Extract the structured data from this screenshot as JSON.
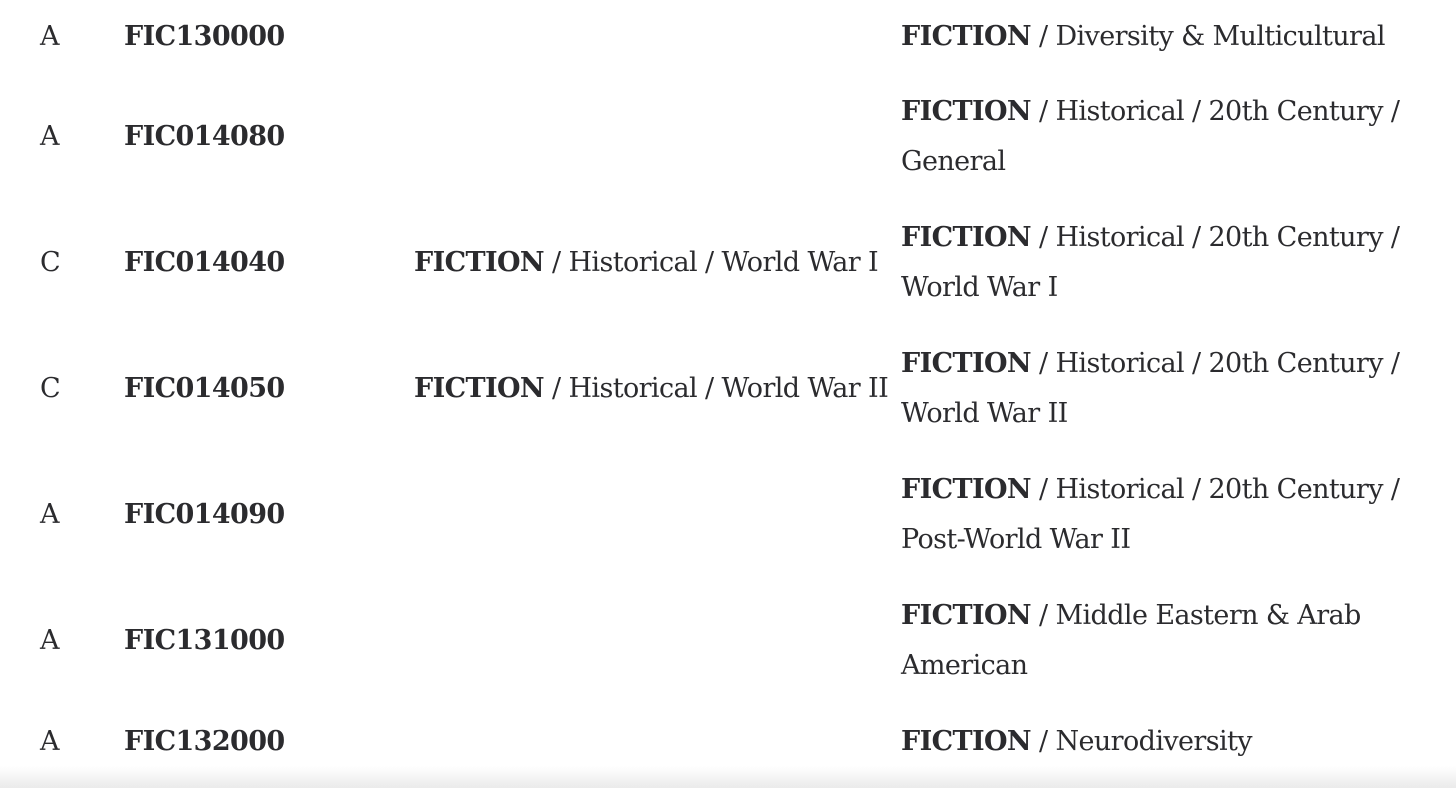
{
  "rows": [
    {
      "status": "A",
      "code": "FIC130000",
      "prev_lead": "",
      "prev_rest": "",
      "curr_lead": "FICTION",
      "curr_rest": " / Diversity & Multicultural"
    },
    {
      "status": "A",
      "code": "FIC014080",
      "prev_lead": "",
      "prev_rest": "",
      "curr_lead": "FICTION",
      "curr_rest": " / Historical / 20th Century / General"
    },
    {
      "status": "C",
      "code": "FIC014040",
      "prev_lead": "FICTION",
      "prev_rest": " / Historical / World War I",
      "curr_lead": "FICTION",
      "curr_rest": " / Historical / 20th Century / World War I"
    },
    {
      "status": "C",
      "code": "FIC014050",
      "prev_lead": "FICTION",
      "prev_rest": " / Historical / World War II",
      "curr_lead": "FICTION",
      "curr_rest": " / Historical / 20th Century / World War II"
    },
    {
      "status": "A",
      "code": "FIC014090",
      "prev_lead": "",
      "prev_rest": "",
      "curr_lead": "FICTION",
      "curr_rest": " / Historical / 20th Century / Post-World War II"
    },
    {
      "status": "A",
      "code": "FIC131000",
      "prev_lead": "",
      "prev_rest": "",
      "curr_lead": "FICTION",
      "curr_rest": " / Middle Eastern & Arab American"
    },
    {
      "status": "A",
      "code": "FIC132000",
      "prev_lead": "",
      "prev_rest": "",
      "curr_lead": "FICTION",
      "curr_rest": " / Neurodiversity"
    }
  ]
}
